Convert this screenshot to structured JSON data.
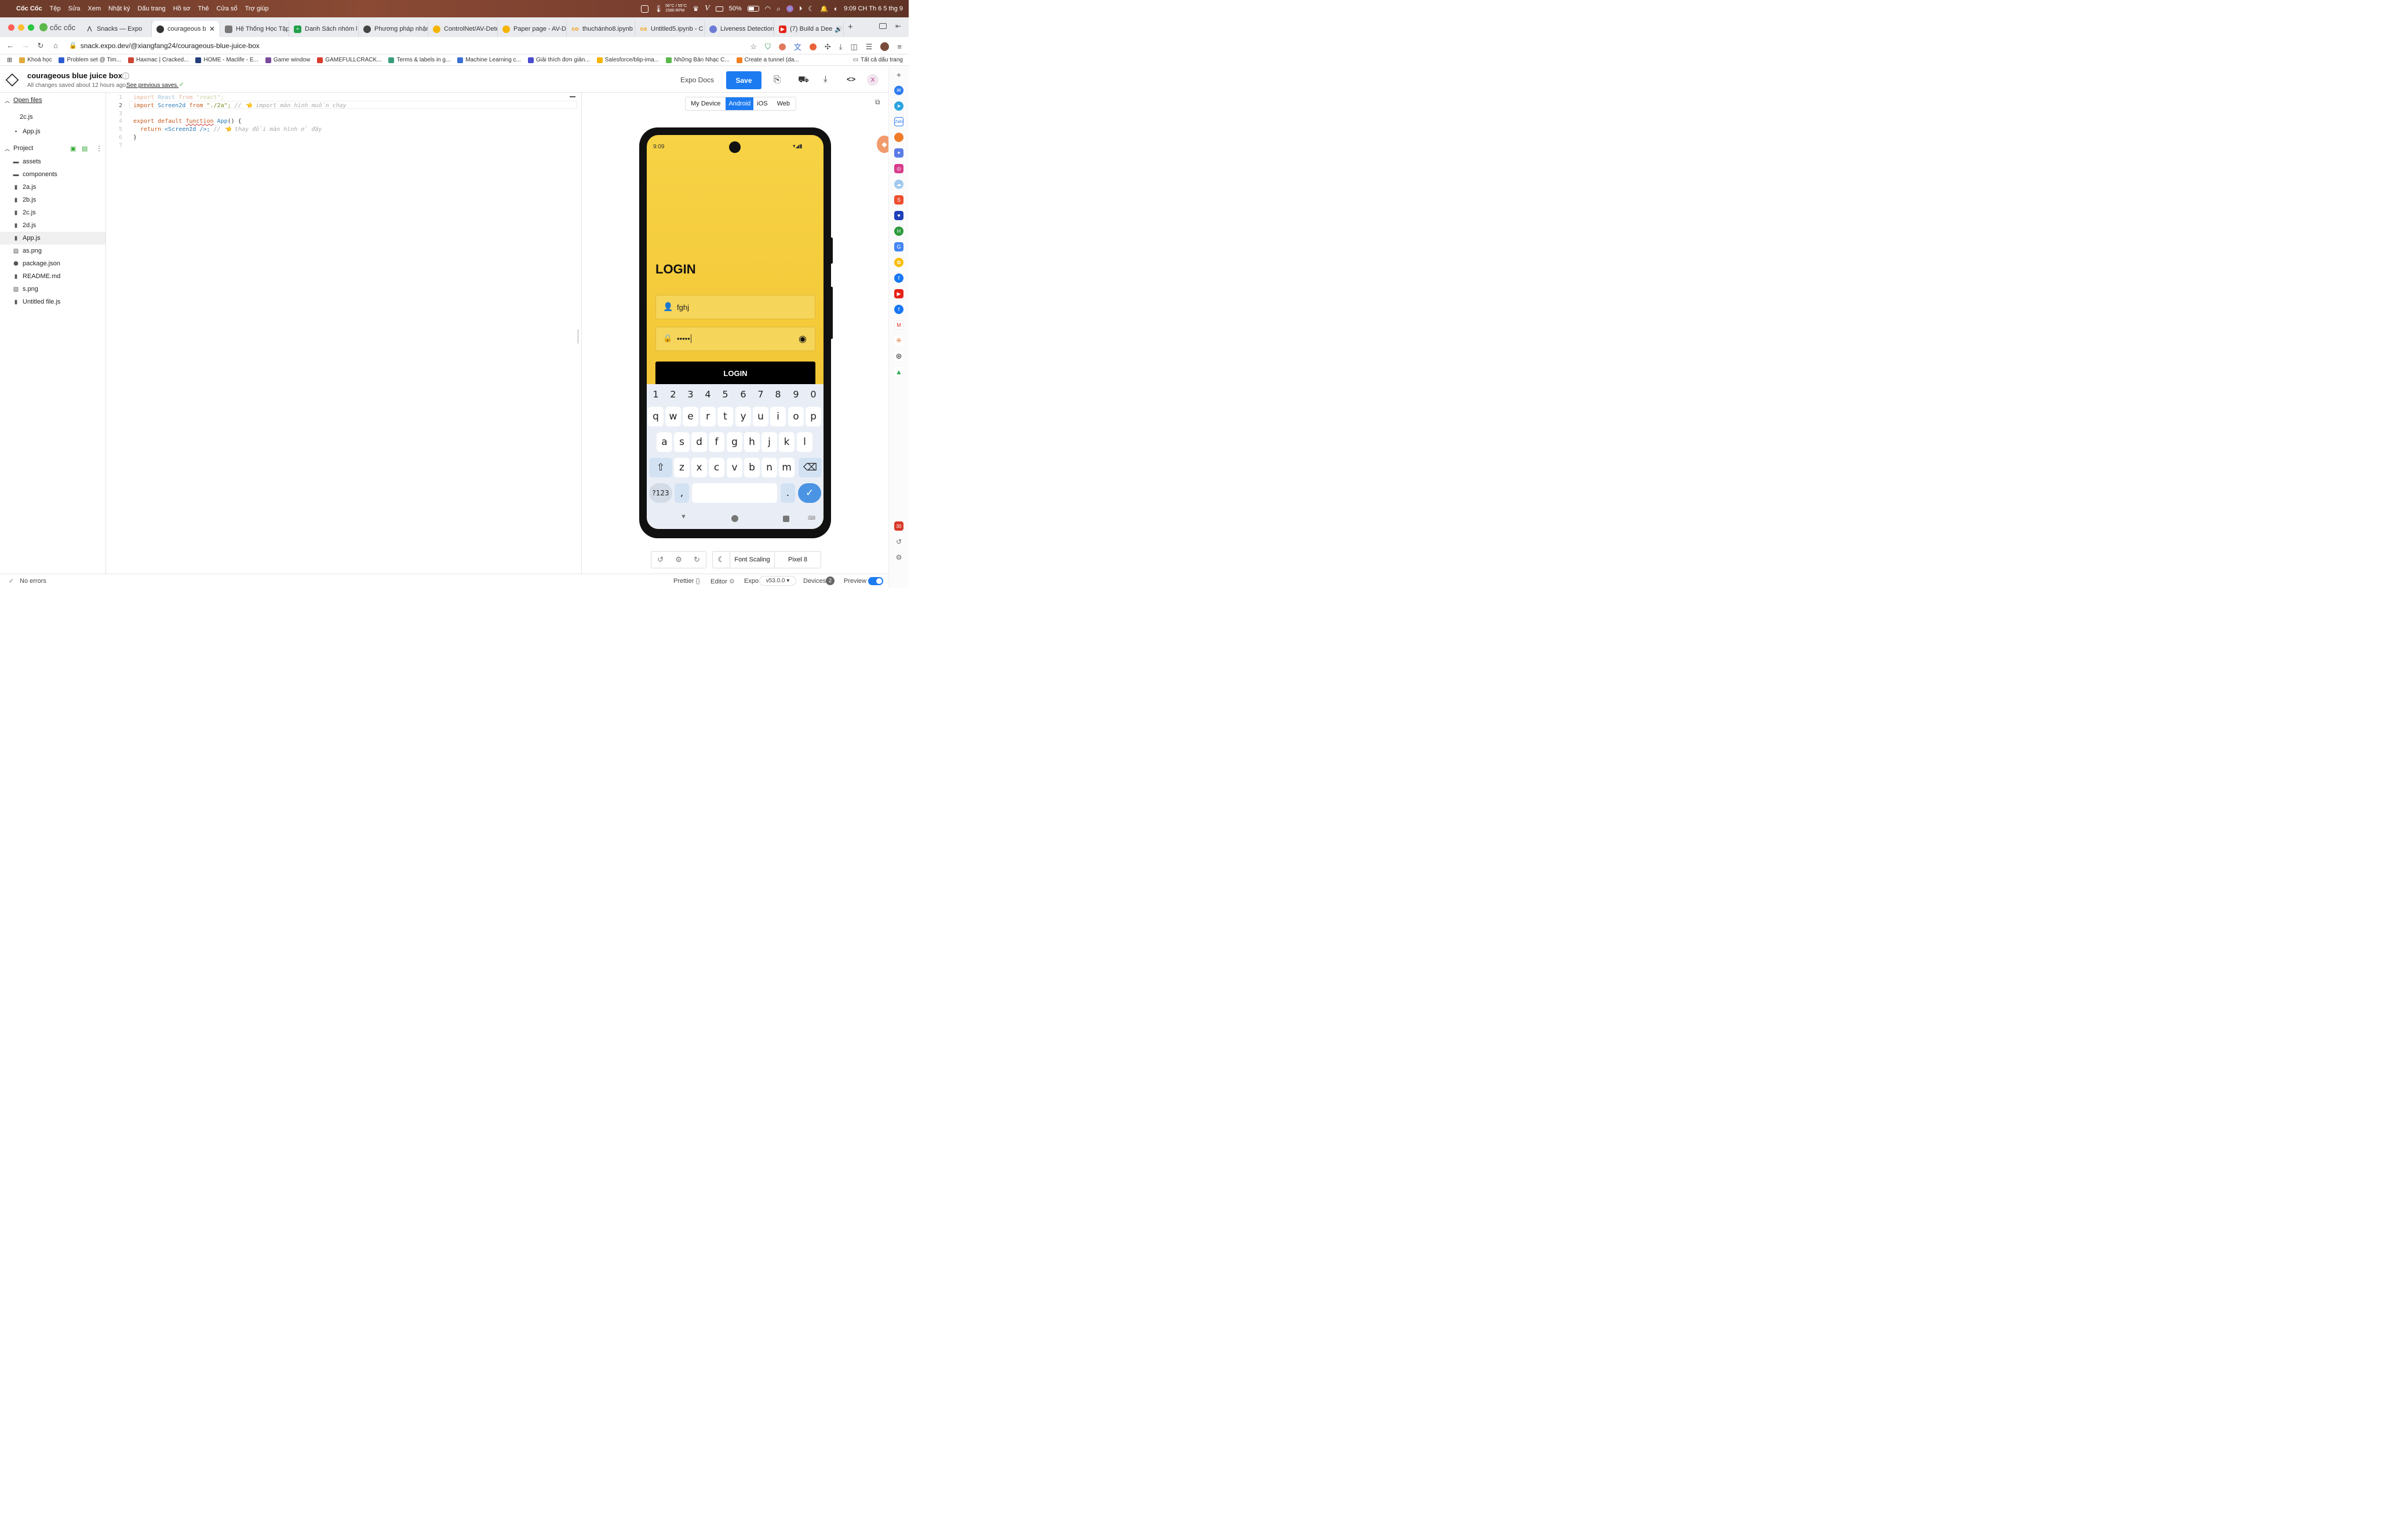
{
  "menubar": {
    "app": "Cốc Cốc",
    "items": [
      "Tệp",
      "Sửa",
      "Xem",
      "Nhật ký",
      "Dấu trang",
      "Hồ sơ",
      "Thẻ",
      "Cửa sổ",
      "Trợ giúp"
    ],
    "temp_top": "56°C / 55°C",
    "temp_bottom": "1580 RPM",
    "battery": "50%",
    "clock": "9:09 CH Th 6 5 thg 9"
  },
  "tabs": [
    {
      "label": "cốc cốc",
      "color": "#5bb84a"
    },
    {
      "label": "Snacks — Expo",
      "color": "#222222"
    },
    {
      "label": "courageous b",
      "color": "#333333"
    },
    {
      "label": "Hệ Thống Học Tập",
      "color": "#666666"
    },
    {
      "label": "Danh Sách nhóm l",
      "color": "#22a04b"
    },
    {
      "label": "Phương pháp nhận",
      "color": "#444444"
    },
    {
      "label": "ControlNet/AV-Dete",
      "color": "#f5b400"
    },
    {
      "label": "Paper page - AV-D",
      "color": "#f5b400"
    },
    {
      "label": "thuchánho8.ipynb",
      "color": "#f49b00"
    },
    {
      "label": "Untitled5.ipynb - C",
      "color": "#f49b00"
    },
    {
      "label": "Liveness Detection",
      "color": "#6b7bd6"
    },
    {
      "label": "(7) Build a Dee",
      "color": "#e62117"
    }
  ],
  "address": {
    "url": "snack.expo.dev/@xiangfang24/courageous-blue-juice-box"
  },
  "bookmarks": [
    {
      "label": "Khoá học",
      "color": "#e0a93b"
    },
    {
      "label": "Problem set @ Tim...",
      "color": "#2d5bd1"
    },
    {
      "label": "Haxmac | Cracked...",
      "color": "#c43"
    },
    {
      "label": "HOME - Maclife - E...",
      "color": "#233e7a"
    },
    {
      "label": "Game window",
      "color": "#7a4b9c"
    },
    {
      "label": "GAMEFULLCRACK...",
      "color": "#d93b2a"
    },
    {
      "label": "Terms & labels in g...",
      "color": "#3a9c7a"
    },
    {
      "label": "Machine Learning c...",
      "color": "#3b6fd1"
    },
    {
      "label": "Giải thích đơn giản...",
      "color": "#4b4bd1"
    },
    {
      "label": "Salesforce/blip-ima...",
      "color": "#f5b400"
    },
    {
      "label": "Những Bản Nhạc C...",
      "color": "#5bb84a"
    },
    {
      "label": "Create a tunnel (da...",
      "color": "#f48120"
    }
  ],
  "bookmarks_all": "Tất cả dấu trang",
  "snack": {
    "title": "courageous blue juice box",
    "saved_text": "All changes saved about 12 hours ago.",
    "saves_link": "See previous saves.",
    "expo_docs": "Expo Docs",
    "save": "Save",
    "avatar": "X"
  },
  "files": {
    "open_files_label": "Open files",
    "open": [
      "2c.js",
      "App.js"
    ],
    "project_label": "Project",
    "folders": [
      "assets",
      "components"
    ],
    "items": [
      "2a.js",
      "2b.js",
      "2c.js",
      "2d.js",
      "App.js",
      "as.png",
      "package.json",
      "README.md",
      "s.png",
      "Untitled file.js"
    ]
  },
  "code": {
    "line_numbers": [
      "1",
      "2",
      "3",
      "4",
      "5",
      "6",
      "7"
    ],
    "l1_kw": "import",
    "l1_name": "React",
    "l1_from": "from",
    "l1_str": "\"react\";",
    "l2_kw": "import",
    "l2_name": "Screen2d",
    "l2_from": "from",
    "l2_str": "\"./2a\";",
    "l2_comment": "// 👈 import màn hình muốn chạy",
    "l4_kw1": "export",
    "l4_kw2": "default",
    "l4_kw3": "function",
    "l4_name": "App",
    "l4_rest": "() {",
    "l5_kw": "return",
    "l5_tag": "<Screen2d />;",
    "l5_comment": "// 👈 thay đổi màn hình ở đây",
    "l6": "}"
  },
  "preview": {
    "tabs": [
      "My Device",
      "Android",
      "iOS",
      "Web"
    ],
    "active_tab": "Android",
    "phone_time": "9:09",
    "login_title": "LOGIN",
    "username_value": "fghj",
    "password_value": "•••••",
    "login_button": "LOGIN",
    "bg_color": "#f7cf3b",
    "keyboard": {
      "numbers": [
        "1",
        "2",
        "3",
        "4",
        "5",
        "6",
        "7",
        "8",
        "9",
        "0"
      ],
      "row1": [
        "q",
        "w",
        "e",
        "r",
        "t",
        "y",
        "u",
        "i",
        "o",
        "p"
      ],
      "row2": [
        "a",
        "s",
        "d",
        "f",
        "g",
        "h",
        "j",
        "k",
        "l"
      ],
      "row3": [
        "z",
        "x",
        "c",
        "v",
        "b",
        "n",
        "m"
      ],
      "symbols": "?123",
      "comma": ",",
      "period": "."
    },
    "font_scaling": "Font Scaling",
    "device": "Pixel 8"
  },
  "status": {
    "errors": "No errors",
    "prettier": "Prettier",
    "editor": "Editor",
    "expo": "Expo",
    "version": "v53.0.0",
    "devices": "Devices",
    "devices_count": "2",
    "preview": "Preview"
  }
}
